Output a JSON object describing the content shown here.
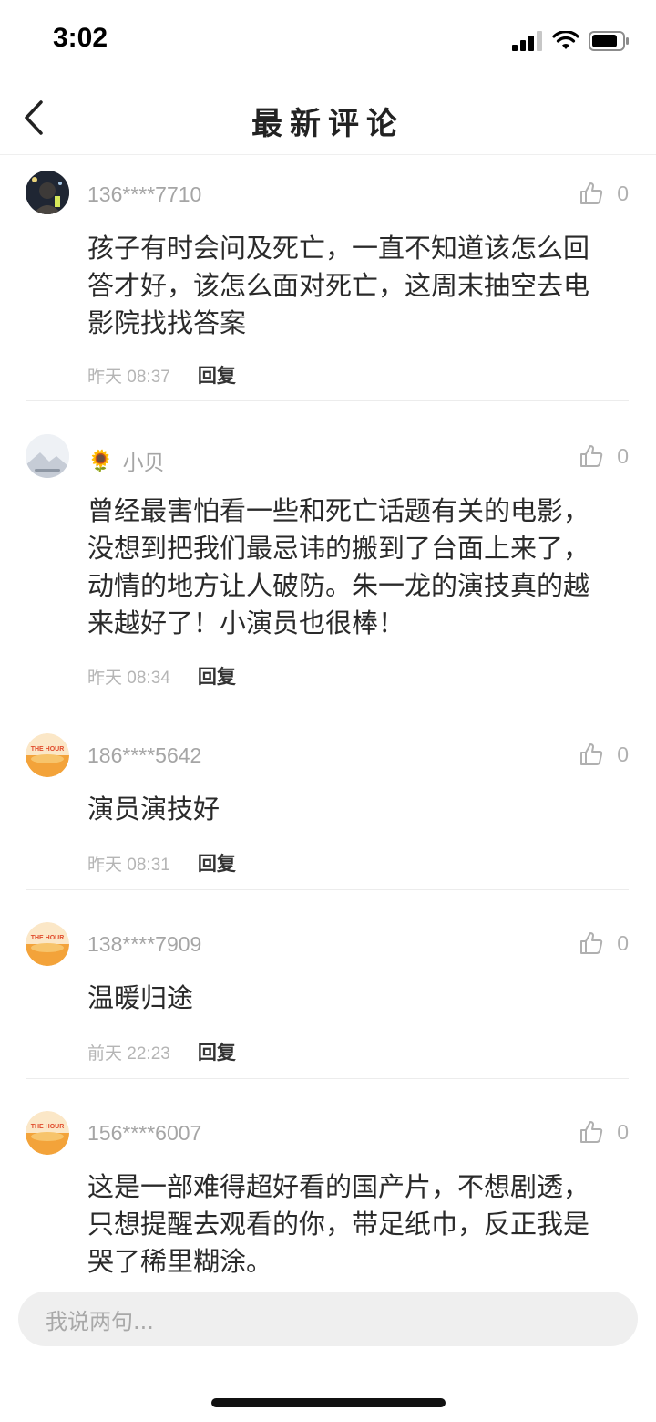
{
  "status_bar": {
    "time": "3:02"
  },
  "header": {
    "title": "最新评论"
  },
  "comments": [
    {
      "username": "136****7710",
      "emoji": "",
      "likes": "0",
      "text": "孩子有时会问及死亡，一直不知道该怎么回答才好，该怎么面对死亡，这周末抽空去电影院找找答案",
      "time": "昨天 08:37",
      "reply": "回复",
      "avatar": "photo-avatar"
    },
    {
      "username": "小贝",
      "emoji": "🌻",
      "likes": "0",
      "text": "曾经最害怕看一些和死亡话题有关的电影，没想到把我们最忌讳的搬到了台面上来了，动情的地方让人破防。朱一龙的演技真的越来越好了！小演员也很棒！",
      "time": "昨天 08:34",
      "reply": "回复",
      "avatar": "landscape-avatar"
    },
    {
      "username": "186****5642",
      "emoji": "",
      "likes": "0",
      "text": "演员演技好",
      "time": "昨天 08:31",
      "reply": "回复",
      "avatar": "the-hour-avatar"
    },
    {
      "username": "138****7909",
      "emoji": "",
      "likes": "0",
      "text": "温暖归途",
      "time": "前天 22:23",
      "reply": "回复",
      "avatar": "the-hour-avatar"
    },
    {
      "username": "156****6007",
      "emoji": "",
      "likes": "0",
      "text": "这是一部难得超好看的国产片，不想剧透，只想提醒去观看的你，带足纸巾，反正我是哭了稀里糊涂。",
      "time": "",
      "reply": "",
      "avatar": "the-hour-avatar"
    }
  ],
  "input": {
    "placeholder": "我说两句..."
  },
  "avatar_logo_text": "THE HOUR",
  "colors": {
    "accent": "#f5a623",
    "text": "#2a2a2a",
    "muted": "#a5a5a5",
    "input_bg": "#efefef"
  },
  "icons": [
    "back-arrow-icon",
    "signal-icon",
    "wifi-icon",
    "battery-icon",
    "thumbs-up-icon"
  ]
}
